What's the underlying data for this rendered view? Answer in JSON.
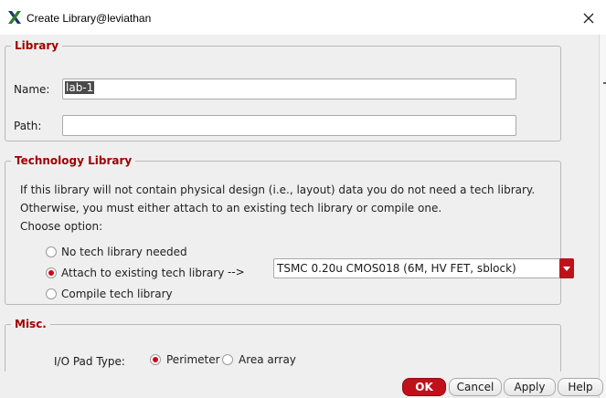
{
  "window": {
    "title": "Create Library@leviathan",
    "app_icon": "cadence-x-icon",
    "close_icon": "close-icon"
  },
  "library": {
    "legend": "Library",
    "name_label": "Name:",
    "name_value": "lab-1",
    "path_label": "Path:",
    "path_value": ""
  },
  "tech": {
    "legend": "Technology Library",
    "line1": "If this library will not contain physical design (i.e., layout) data you do not need a tech library.",
    "line2": "Otherwise, you must either attach to an existing tech library or compile one.",
    "line3": "Choose option:",
    "options": [
      {
        "label": "No tech library needed",
        "checked": false
      },
      {
        "label": "Attach to existing tech library",
        "checked": true
      },
      {
        "label": "Compile tech library",
        "checked": false
      }
    ],
    "arrow": "-->",
    "selected_library": "TSMC 0.20u CMOS018 (6M, HV FET, sblock)"
  },
  "misc": {
    "legend": "Misc.",
    "pad_label": "I/O Pad Type:",
    "pad_options": [
      {
        "label": "Perimeter",
        "checked": true
      },
      {
        "label": "Area array",
        "checked": false
      }
    ]
  },
  "buttons": {
    "ok": "OK",
    "cancel": "Cancel",
    "apply": "Apply",
    "help": "Help"
  },
  "colors": {
    "accent": "#c2101b",
    "legend": "#a00000",
    "dialog_bg": "#efefef"
  }
}
